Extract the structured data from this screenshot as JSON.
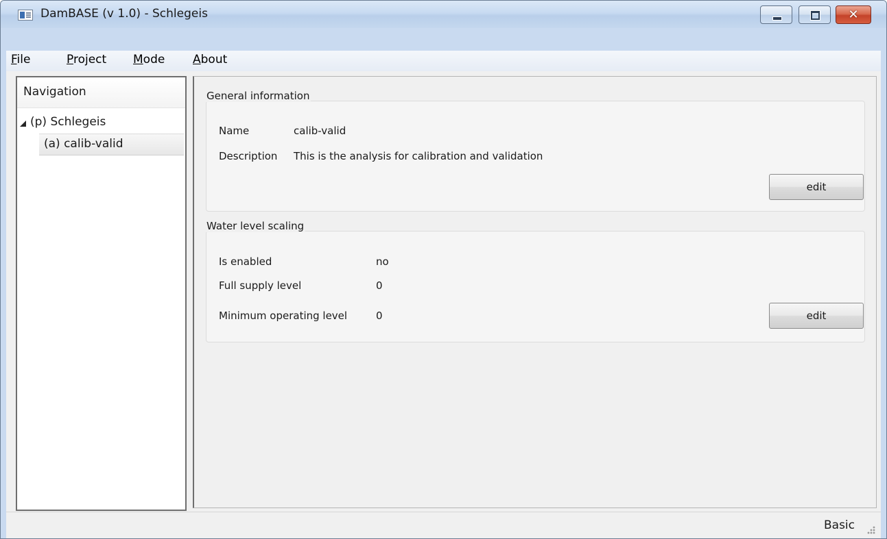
{
  "window": {
    "title": "DamBASE (v 1.0) - Schlegeis",
    "controls": {
      "minimize_icon": "minimize-icon",
      "maximize_icon": "maximize-icon",
      "close_icon": "close-icon",
      "close_glyph": "✕"
    }
  },
  "menu": {
    "items": [
      {
        "accel": "F",
        "rest": "ile"
      },
      {
        "accel": "P",
        "rest": "roject"
      },
      {
        "accel": "M",
        "rest": "ode"
      },
      {
        "accel": "A",
        "rest": "bout"
      }
    ]
  },
  "navigation": {
    "header": "Navigation",
    "tree": {
      "root": "(p) Schlegeis",
      "children": [
        "(a) calib-valid"
      ]
    }
  },
  "general_information": {
    "title": "General information",
    "fields": [
      {
        "label": "Name",
        "value": "calib-valid"
      },
      {
        "label": "Description",
        "value": "This is the analysis for calibration and validation"
      }
    ],
    "edit_label": "edit"
  },
  "water_level_scaling": {
    "title": "Water level scaling",
    "fields": [
      {
        "label": "Is enabled",
        "value": "no"
      },
      {
        "label": "Full supply level",
        "value": "0"
      },
      {
        "label": "Minimum operating level",
        "value": "0"
      }
    ],
    "edit_label": "edit"
  },
  "status_bar": {
    "mode_text": "Basic"
  },
  "colors": {
    "title_bar": "#c7daf1",
    "close_button": "#c4432a",
    "panel_border": "#6e6e6e",
    "background": "#f0f0f0"
  }
}
